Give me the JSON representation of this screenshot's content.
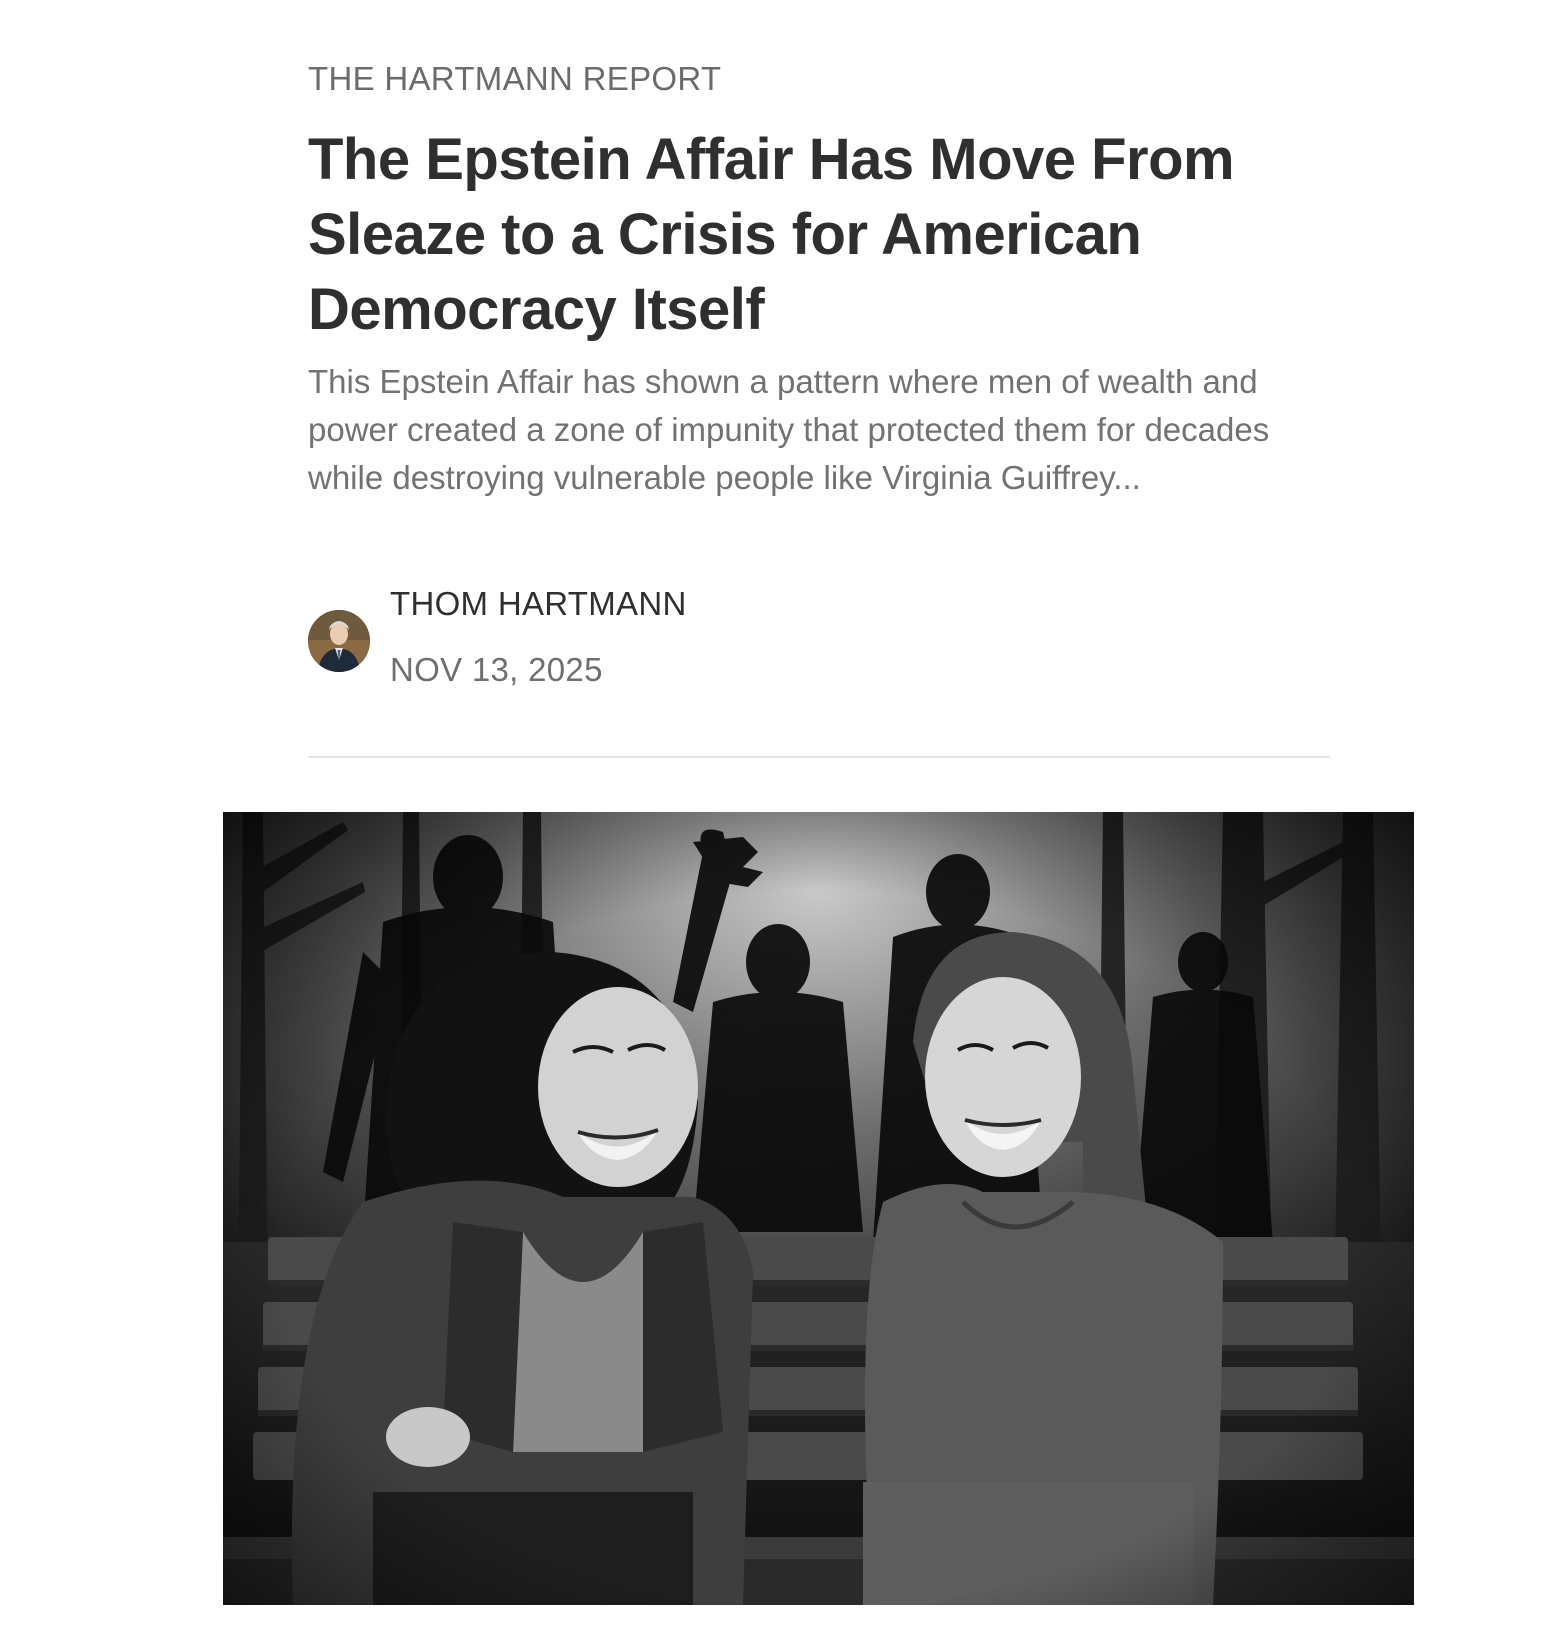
{
  "post": {
    "publication": "THE HARTMANN REPORT",
    "headline": "The Epstein Affair Has Move From Sleaze to a Crisis for American Democracy Itself",
    "subtitle": "This Epstein Affair has shown a pattern where men of wealth and power created a zone of impunity that protected them for decades while destroying vulnerable people like Virginia Guiffrey...",
    "author": "THOM HARTMANN",
    "date": "NOV 13, 2025"
  },
  "hero_image": {
    "description_icon": "photo-image",
    "style": "black-and-white"
  },
  "colors": {
    "text_primary": "#2f2f2f",
    "text_secondary": "#6f6f6f",
    "divider": "#e6e6e6"
  }
}
